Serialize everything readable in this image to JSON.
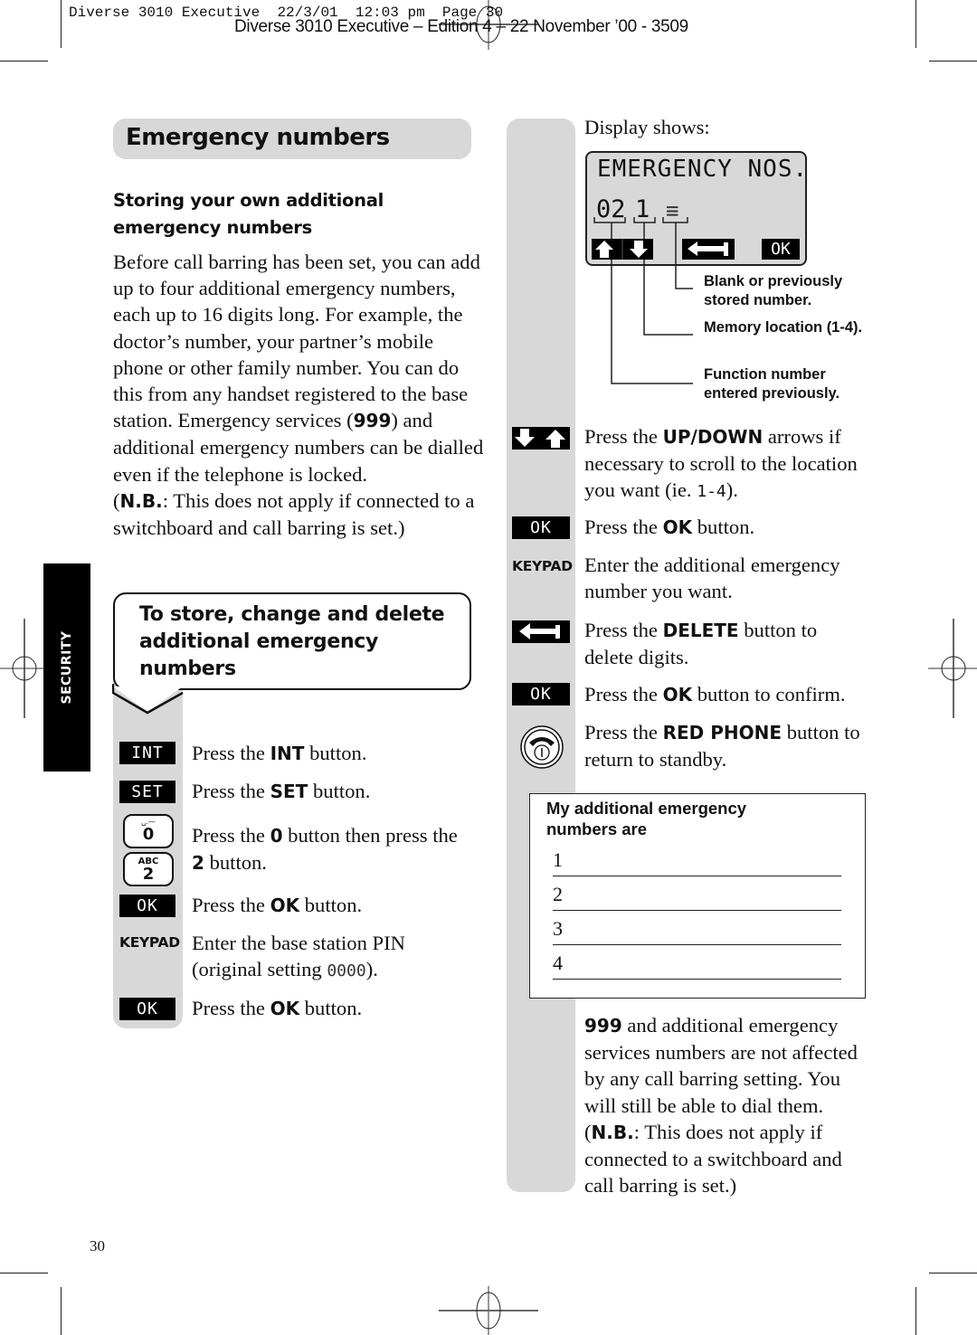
{
  "print_slug": "Diverse 3010 Executive  22/3/01  12:03 pm  Page 30",
  "edition_line": "Diverse 3010 Executive – Edition 4 – 22 November ’00 - 3509",
  "section_tab": "SECURITY",
  "title": "Emergency numbers",
  "subheading": "Storing your own additional emergency numbers",
  "intro": {
    "p1": "Before call barring has been set, you can add up to four additional emergency numbers, each up to 16 digits long. For example, the doctor’s number, your partner’s mobile phone or other family number. You can do this from any handset registered to the base station. Emergency services (",
    "p1_bold": "999",
    "p1_end": ") and additional emergency numbers can be dialled even if the telephone is locked.",
    "nb_open": "(",
    "nb_bold": "N.B.",
    "nb_text": ": This does not apply if connected to a switchboard and call barring is set.)"
  },
  "procedure_heading": "To store, change and delete additional emergency numbers",
  "left_steps": [
    {
      "key": "INT",
      "pre": "Press the ",
      "bold": "INT",
      "post": " button."
    },
    {
      "key": "SET",
      "pre": "Press the ",
      "bold": "SET",
      "post": " button."
    },
    {
      "key0_sub": "␣.—",
      "key0": "0",
      "key2_sub": "ABC",
      "key2": "2",
      "pre": "Press the ",
      "bold": "0",
      "mid": " button then press the ",
      "bold2": "2",
      "post": " button."
    },
    {
      "key": "OK",
      "pre": "Press the ",
      "bold": "OK",
      "post": " button."
    },
    {
      "key": "KEYPAD",
      "pre": "Enter the base station PIN (original setting ",
      "lcd": "0000",
      "post": ")."
    },
    {
      "key": "OK",
      "pre": "Press the ",
      "bold": "OK",
      "post": " button."
    }
  ],
  "display": {
    "label": "Display shows:",
    "line1": "EMERGENCY NOS.",
    "function_no": "02",
    "location": "1",
    "stored": "≡",
    "ok": "OK",
    "callouts": [
      "Blank or previously stored number.",
      "Memory location (1-4).",
      "Function number entered previously."
    ]
  },
  "right_steps": [
    {
      "key": "UP/DOWN",
      "pre": "Press the ",
      "bold": "UP/DOWN",
      "post": " arrows if necessary to scroll to the location you want (ie. ",
      "lcd": "1-4",
      "end": ")."
    },
    {
      "key": "OK",
      "pre": "Press the ",
      "bold": "OK",
      "post": " button."
    },
    {
      "key": "KEYPAD",
      "pre": "Enter the additional emergency number you want."
    },
    {
      "key": "DELETE",
      "pre": "Press the ",
      "bold": "DELETE",
      "post": " button to delete digits."
    },
    {
      "key": "OK",
      "pre": "Press the ",
      "bold": "OK",
      "post": " button to confirm."
    },
    {
      "key": "RED PHONE",
      "pre": "Press the ",
      "bold": "RED PHONE",
      "post": " button to return to standby."
    }
  ],
  "numbers_box": {
    "title": "My additional emergency numbers are",
    "lines": [
      "1",
      "2",
      "3",
      "4"
    ]
  },
  "footer_note": {
    "bold": "999",
    "text": " and additional emergency services numbers are not affected by any call barring setting. You will still be able to dial them.",
    "nb_open": "(",
    "nb_bold": "N.B.",
    "nb_text": ": This does not apply if connected to a switchboard and call barring is set.)"
  },
  "page_number": "30"
}
